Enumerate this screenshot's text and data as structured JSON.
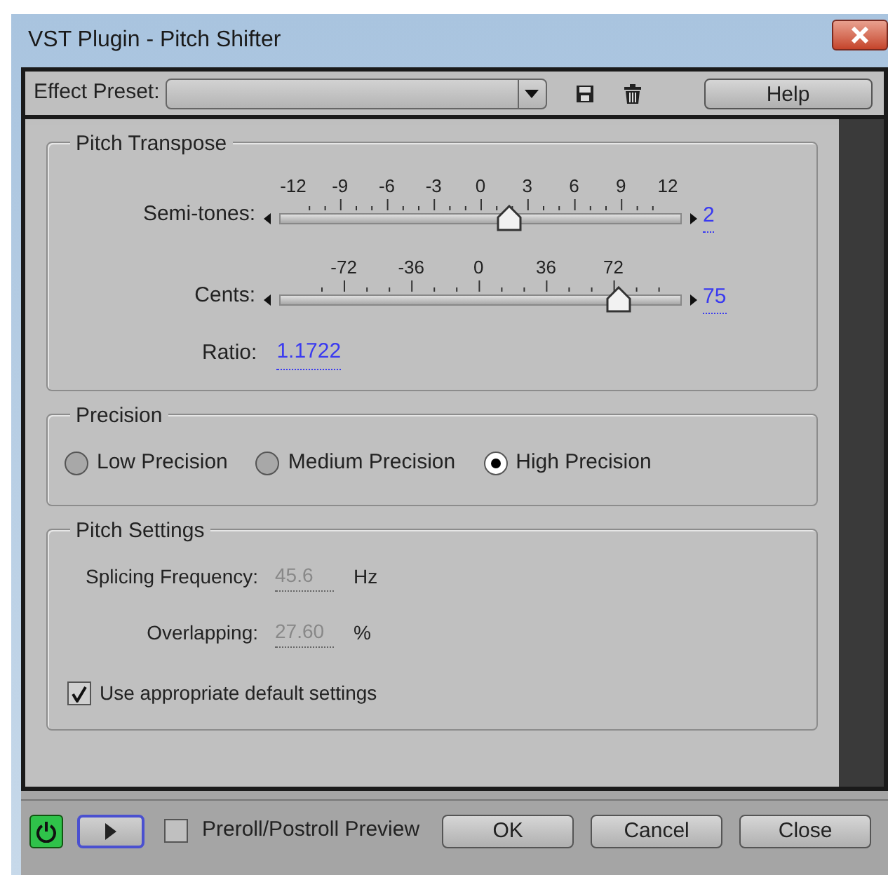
{
  "window": {
    "title": "VST Plugin - Pitch Shifter"
  },
  "toolbar": {
    "preset_label": "Effect Preset:",
    "help_button": "Help"
  },
  "pitch_transpose": {
    "title": "Pitch Transpose",
    "sliders": [
      {
        "label": "Semi-tones:",
        "ticks": [
          "-12",
          "-9",
          "-6",
          "-3",
          "0",
          "3",
          "6",
          "9",
          "12"
        ],
        "level": 0.58,
        "value": "2"
      },
      {
        "label": "Cents:",
        "ticks": [
          "-72",
          "-36",
          "0",
          "36",
          "72"
        ],
        "level": 0.873,
        "value": "75"
      }
    ],
    "ratio_label": "Ratio:",
    "ratio_value": "1.1722"
  },
  "precision": {
    "title": "Precision",
    "options": [
      {
        "label": "Low Precision",
        "selected": false
      },
      {
        "label": "Medium Precision",
        "selected": false
      },
      {
        "label": "High Precision",
        "selected": true
      }
    ]
  },
  "pitch_settings": {
    "title": "Pitch Settings",
    "fields": [
      {
        "label": "Splicing Frequency:",
        "value": "45.6",
        "unit": "Hz",
        "disabled": true
      },
      {
        "label": "Overlapping:",
        "value": "27.60",
        "unit": "%",
        "disabled": true
      }
    ],
    "default_checkbox": {
      "label": "Use appropriate default settings",
      "checked": true
    }
  },
  "footer": {
    "power_on": true,
    "preview_checkbox": {
      "label": "Preroll/Postroll Preview",
      "checked": false
    },
    "buttons": [
      "OK",
      "Cancel",
      "Close"
    ]
  }
}
